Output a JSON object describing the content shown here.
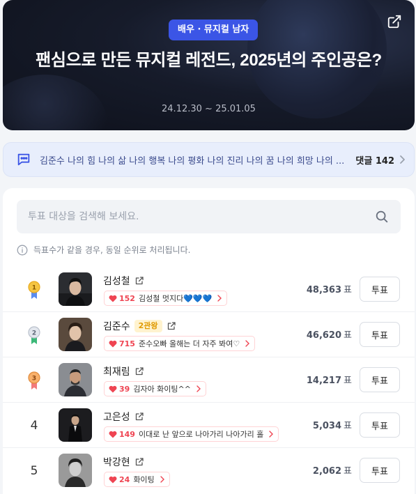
{
  "hero": {
    "badge": "배우 · 뮤지컬 남자",
    "title": "팬심으로 만든 뮤지컬 레전드, 2025년의 주인공은?",
    "date_range": "24.12.30 ~ 25.01.05",
    "share_icon": "share-icon"
  },
  "comments": {
    "preview": "김준수 나의 힘 나의 삶 나의 행복 나의 평화 나의 진리 나의 꿈 나의 희망 나의 ...",
    "count_label": "댓글 142",
    "icon": "comment-icon"
  },
  "search": {
    "placeholder": "투표 대상을 검색해 보세요."
  },
  "notice": "득표수가 같을 경우, 동일 순위로 처리됩니다.",
  "candidates": [
    {
      "rank": "1",
      "medal": "gold",
      "name": "김성철",
      "badge": "",
      "cheer_count": "152",
      "cheer_text": "김성철 멋지다💙💙💙",
      "votes": "48,363",
      "unit": "표",
      "vote_label": "투표"
    },
    {
      "rank": "2",
      "medal": "silver",
      "name": "김준수",
      "badge": "2관왕",
      "cheer_count": "715",
      "cheer_text": "준수오빠 올해는 더 자주 봐여♡",
      "votes": "46,620",
      "unit": "표",
      "vote_label": "투표"
    },
    {
      "rank": "3",
      "medal": "bronze",
      "name": "최재림",
      "badge": "",
      "cheer_count": "39",
      "cheer_text": "김자아 화이팅^^",
      "votes": "14,217",
      "unit": "표",
      "vote_label": "투표"
    },
    {
      "rank": "4",
      "medal": "",
      "name": "고은성",
      "badge": "",
      "cheer_count": "149",
      "cheer_text": "이대로 난 앞으로 나아가리 나아가리 홀",
      "votes": "5,034",
      "unit": "표",
      "vote_label": "투표"
    },
    {
      "rank": "5",
      "medal": "",
      "name": "박강현",
      "badge": "",
      "cheer_count": "24",
      "cheer_text": "화이팅",
      "votes": "2,062",
      "unit": "표",
      "vote_label": "투표"
    }
  ],
  "colors": {
    "accent": "#3b55e6",
    "heart": "#ef4452",
    "gold": "#f2b824",
    "silver": "#b9c0cb",
    "bronze": "#f0a060"
  }
}
